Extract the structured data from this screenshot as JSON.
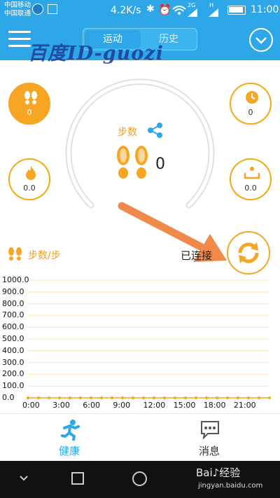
{
  "status_bar": {
    "carrier1": "中国移动",
    "carrier2": "中国联通",
    "speed": "4.2K/s",
    "signal_tag1": "2G",
    "signal_tag2": "H",
    "time": "11:00"
  },
  "header": {
    "tab_active": "运动",
    "tab_inactive": "历史",
    "watermark": "百度ID-guozi"
  },
  "stats": {
    "steps_top": "0",
    "time_value": "0",
    "calories": "0.0",
    "weight": "0.0"
  },
  "center": {
    "label": "步数",
    "value": "0"
  },
  "chart_header": {
    "title": "步数/步",
    "connection": "已连接"
  },
  "chart_data": {
    "type": "line",
    "x": [
      "0:00",
      "3:00",
      "6:00",
      "9:00",
      "12:00",
      "15:00",
      "18:00",
      "21:00"
    ],
    "yticks": [
      "1000.0",
      "900.0",
      "800.0",
      "700.0",
      "600.0",
      "500.0",
      "400.0",
      "300.0",
      "200.0",
      "100.0",
      "0.0"
    ],
    "ylim": [
      0,
      1000
    ],
    "series": [
      {
        "values": [
          0,
          0,
          0,
          0,
          0,
          0,
          0,
          0,
          0,
          0,
          0,
          0,
          0,
          0,
          0,
          0,
          0,
          0,
          0,
          0,
          0,
          0,
          0,
          0
        ]
      }
    ],
    "color": "#f6a623",
    "grid": true
  },
  "tabs": {
    "health": "健康",
    "messages": "消息"
  },
  "watermark_bottom": {
    "brand": "Bai♪经验",
    "url": "jingyan.baidu.com"
  }
}
